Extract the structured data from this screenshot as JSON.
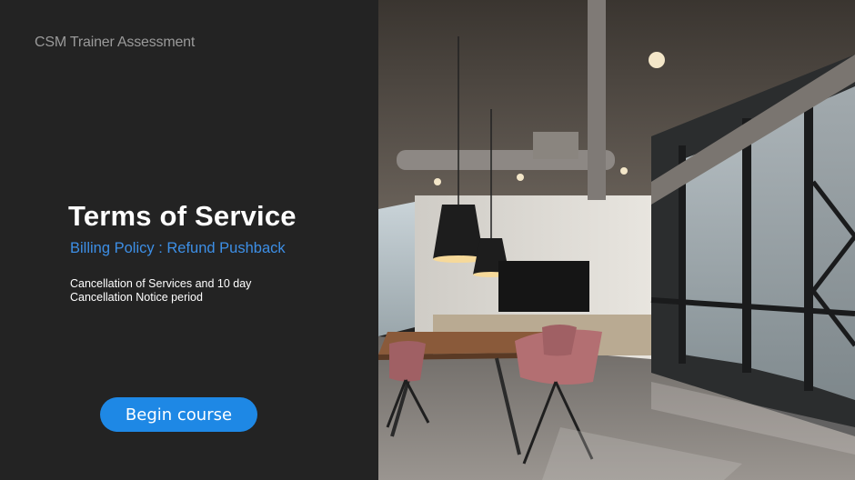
{
  "slide": {
    "kicker": "CSM Trainer Assessment",
    "title": "Terms of Service",
    "subtitle": "Billing Policy : Refund Pushback",
    "description": "Cancellation of Services and 10 day Cancellation Notice period",
    "begin_button": "Begin course"
  },
  "colors": {
    "panel_bg": "#232323",
    "subtitle": "#3d8fe6",
    "button": "#1e88e5"
  },
  "photo": {
    "subject": "office-meeting-room"
  }
}
